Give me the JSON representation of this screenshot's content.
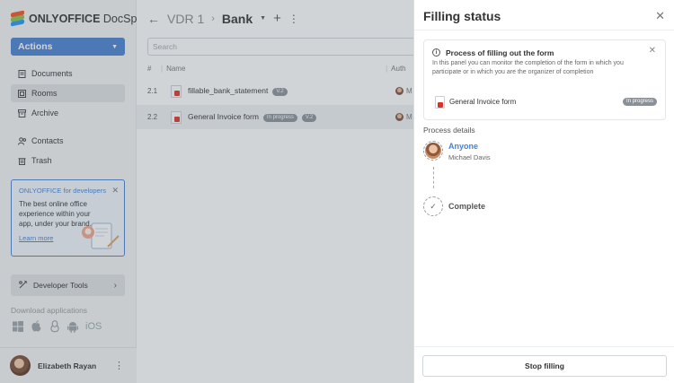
{
  "app": {
    "brand_bold": "ONLYOFFICE",
    "brand_rest": " DocSpace"
  },
  "sidebar": {
    "actions_label": "Actions",
    "items": [
      {
        "label": "Documents",
        "icon": "document-icon"
      },
      {
        "label": "Rooms",
        "icon": "rooms-icon",
        "active": true
      },
      {
        "label": "Archive",
        "icon": "archive-icon"
      },
      {
        "label": "Contacts",
        "icon": "contacts-icon"
      },
      {
        "label": "Trash",
        "icon": "trash-icon"
      }
    ],
    "dev_card": {
      "title": "ONLYOFFICE for developers",
      "body": "The best online office experience within your app, under your brand.",
      "link": "Learn more"
    },
    "dev_tools_label": "Developer Tools",
    "download_label": "Download applications",
    "download_ios": "iOS",
    "user_name": "Elizabeth Rayan"
  },
  "main": {
    "breadcrumb_root": "VDR 1",
    "breadcrumb_current": "Bank",
    "search_placeholder": "Search",
    "columns": {
      "hash": "#",
      "name": "Name",
      "author": "Auth"
    },
    "rows": [
      {
        "index": "2.1",
        "name": "fillable_bank_statement",
        "version": "V.2",
        "author_initial": "M"
      },
      {
        "index": "2.2",
        "name": "General Invoice form",
        "status": "In progress",
        "version": "V.2",
        "author_initial": "M"
      }
    ]
  },
  "panel": {
    "title": "Filling status",
    "info_title": "Process of filling out the form",
    "info_text": "In this panel you can monitor the completion of the form in which you participate or in which you are the organizer of completion",
    "form_name": "General Invoice form",
    "form_status": "In progress",
    "process_label": "Process details",
    "step1_title": "Anyone",
    "step1_user": "Michael Davis",
    "step2_title": "Complete",
    "stop_label": "Stop filling"
  }
}
